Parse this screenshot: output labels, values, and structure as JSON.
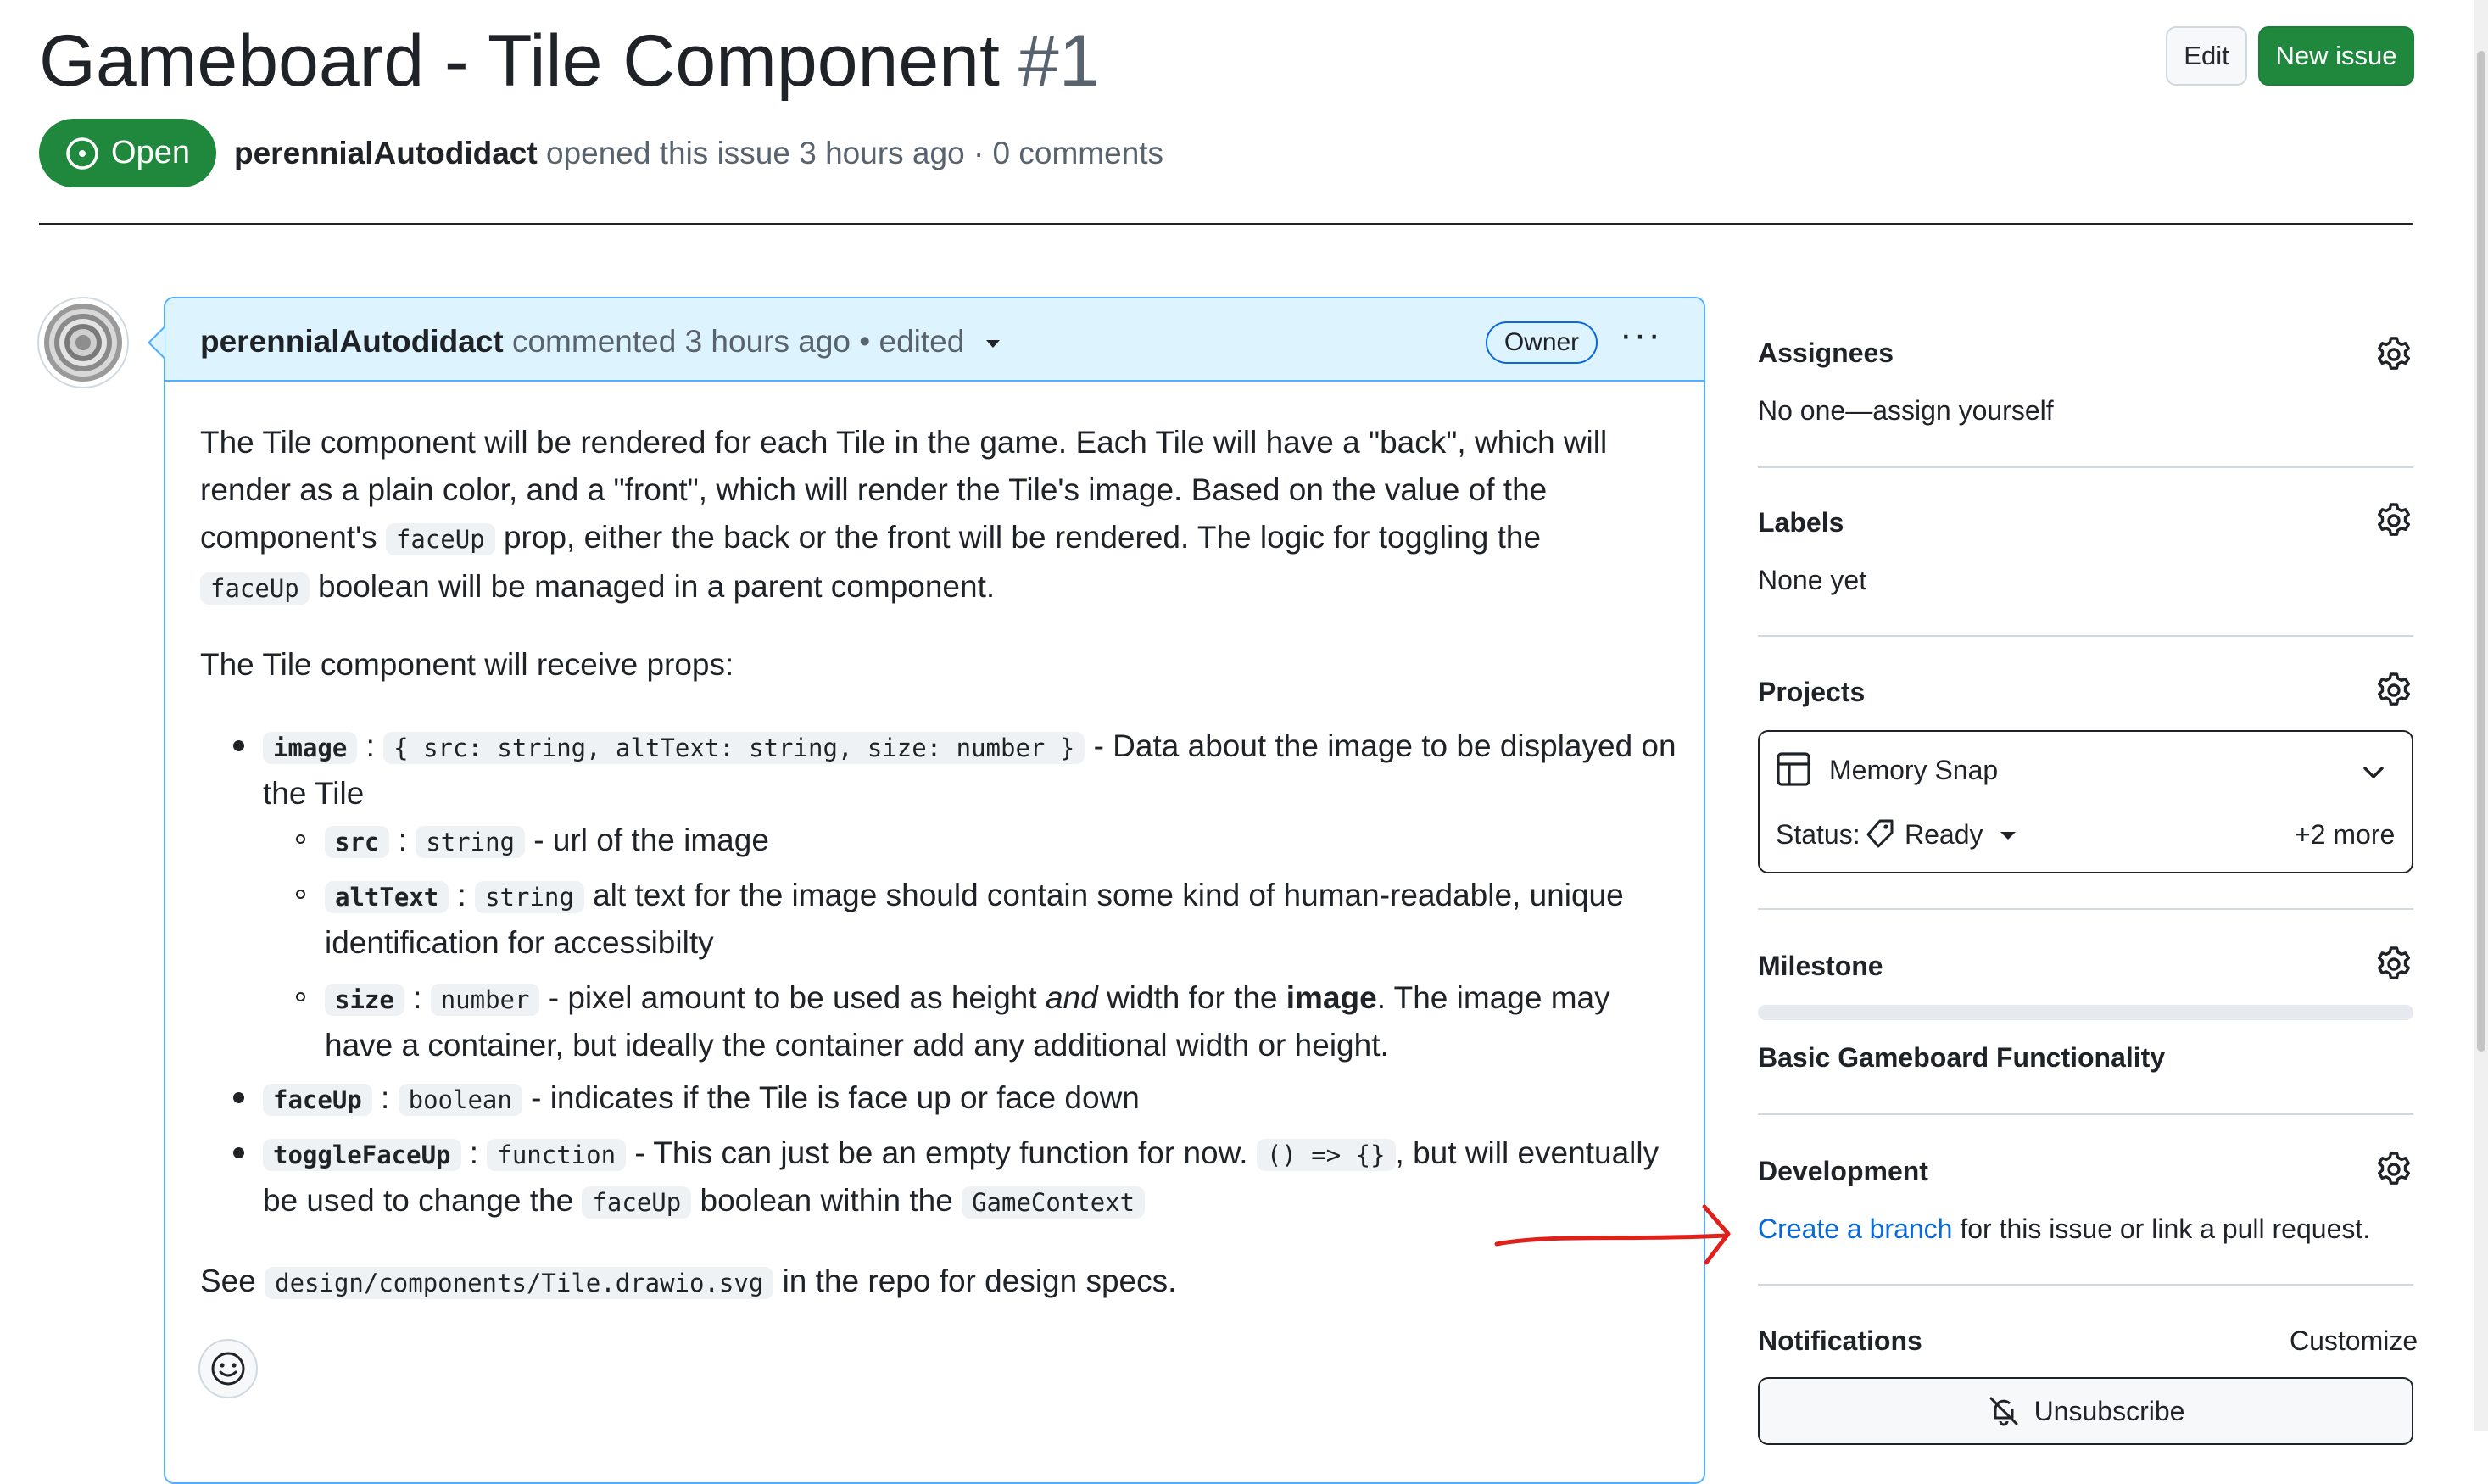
{
  "header": {
    "title": "Gameboard - Tile Component",
    "number": "#1",
    "edit_label": "Edit",
    "new_issue_label": "New issue",
    "status": "Open",
    "author": "perennialAutodidact",
    "byline_rest": " opened this issue 3 hours ago · 0 comments"
  },
  "comment": {
    "author": "perennialAutodidact",
    "meta": " commented 3 hours ago • edited",
    "owner_badge": "Owner",
    "para1": {
      "t1": "The Tile component will be rendered for each Tile in the game. Each Tile will have a \"back\", which will",
      "t2": "render as a plain color, and a \"front\", which will render the Tile's image. Based on the value of the",
      "t3a": "component's ",
      "code1": "faceUp",
      "t3b": " prop, either the back or the front will be rendered. The logic for toggling the",
      "code2": "faceUp",
      "t4": " boolean will be managed in a parent component."
    },
    "para2": "The Tile component will receive props:",
    "items": {
      "image_name": "image",
      "image_type": "{ src: string, altText: string, size: number }",
      "image_desc1": " - Data about the image to be displayed on",
      "image_desc2": "the Tile",
      "src_name": "src",
      "src_type": "string",
      "src_desc": " - url of the image",
      "alt_name": "altText",
      "alt_type": "string",
      "alt_desc1": " alt text for the image should contain some kind of human-readable, unique",
      "alt_desc2": "identification for accessibilty",
      "size_name": "size",
      "size_type": "number",
      "size_desc_a": " - pixel amount to be used as height ",
      "size_desc_em": "and",
      "size_desc_b": " width for the ",
      "size_desc_strong": "image",
      "size_desc_c": ". The image may",
      "size_desc2": "have a container, but ideally the container add any additional width or height.",
      "face_name": "faceUp",
      "face_type": "boolean",
      "face_desc": " - indicates if the Tile is face up or face down",
      "toggle_name": "toggleFaceUp",
      "toggle_type": "function",
      "toggle_desc_a": " - This can just be an empty function for now. ",
      "toggle_code": "() => {}",
      "toggle_desc_b": ", but will eventually",
      "toggle_desc2a": "be used to change the ",
      "toggle_code2": "faceUp",
      "toggle_desc2b": " boolean within the ",
      "toggle_code3": "GameContext"
    },
    "para3": {
      "a": "See ",
      "code": "design/components/Tile.drawio.svg",
      "b": " in the repo for design specs."
    }
  },
  "sidebar": {
    "assignees_title": "Assignees",
    "assignees_value": "No one—assign yourself",
    "labels_title": "Labels",
    "labels_value": "None yet",
    "projects_title": "Projects",
    "project_name": "Memory Snap",
    "status_label": "Status:",
    "status_value": "Ready",
    "more": "+2 more",
    "milestone_title": "Milestone",
    "milestone_value": "Basic Gameboard Functionality",
    "milestone_progress": 0,
    "development_title": "Development",
    "dev_link": "Create a branch",
    "dev_rest": " for this issue or link a pull request.",
    "notifications_title": "Notifications",
    "customize": "Customize",
    "unsubscribe": "Unsubscribe"
  },
  "colors": {
    "primary_green": "#1f883d",
    "link_blue": "#0969da",
    "comment_header": "#ddf4ff",
    "annotation_red": "#e0201b"
  }
}
